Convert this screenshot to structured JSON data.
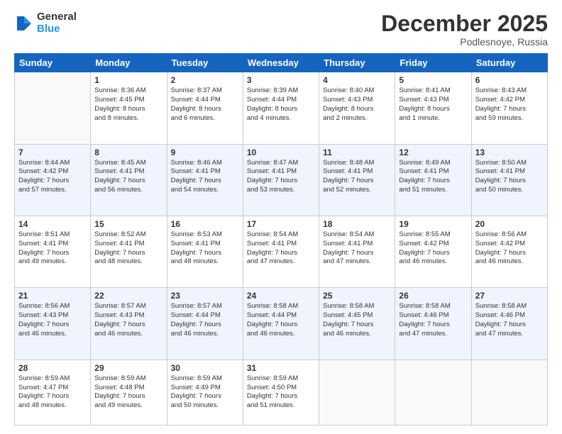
{
  "logo": {
    "general": "General",
    "blue": "Blue"
  },
  "header": {
    "month": "December 2025",
    "location": "Podlesnoye, Russia"
  },
  "weekdays": [
    "Sunday",
    "Monday",
    "Tuesday",
    "Wednesday",
    "Thursday",
    "Friday",
    "Saturday"
  ],
  "weeks": [
    [
      {
        "day": "",
        "info": ""
      },
      {
        "day": "1",
        "info": "Sunrise: 8:36 AM\nSunset: 4:45 PM\nDaylight: 8 hours\nand 8 minutes."
      },
      {
        "day": "2",
        "info": "Sunrise: 8:37 AM\nSunset: 4:44 PM\nDaylight: 8 hours\nand 6 minutes."
      },
      {
        "day": "3",
        "info": "Sunrise: 8:39 AM\nSunset: 4:44 PM\nDaylight: 8 hours\nand 4 minutes."
      },
      {
        "day": "4",
        "info": "Sunrise: 8:40 AM\nSunset: 4:43 PM\nDaylight: 8 hours\nand 2 minutes."
      },
      {
        "day": "5",
        "info": "Sunrise: 8:41 AM\nSunset: 4:43 PM\nDaylight: 8 hours\nand 1 minute."
      },
      {
        "day": "6",
        "info": "Sunrise: 8:43 AM\nSunset: 4:42 PM\nDaylight: 7 hours\nand 59 minutes."
      }
    ],
    [
      {
        "day": "7",
        "info": "Sunrise: 8:44 AM\nSunset: 4:42 PM\nDaylight: 7 hours\nand 57 minutes."
      },
      {
        "day": "8",
        "info": "Sunrise: 8:45 AM\nSunset: 4:41 PM\nDaylight: 7 hours\nand 56 minutes."
      },
      {
        "day": "9",
        "info": "Sunrise: 8:46 AM\nSunset: 4:41 PM\nDaylight: 7 hours\nand 54 minutes."
      },
      {
        "day": "10",
        "info": "Sunrise: 8:47 AM\nSunset: 4:41 PM\nDaylight: 7 hours\nand 53 minutes."
      },
      {
        "day": "11",
        "info": "Sunrise: 8:48 AM\nSunset: 4:41 PM\nDaylight: 7 hours\nand 52 minutes."
      },
      {
        "day": "12",
        "info": "Sunrise: 8:49 AM\nSunset: 4:41 PM\nDaylight: 7 hours\nand 51 minutes."
      },
      {
        "day": "13",
        "info": "Sunrise: 8:50 AM\nSunset: 4:41 PM\nDaylight: 7 hours\nand 50 minutes."
      }
    ],
    [
      {
        "day": "14",
        "info": "Sunrise: 8:51 AM\nSunset: 4:41 PM\nDaylight: 7 hours\nand 49 minutes."
      },
      {
        "day": "15",
        "info": "Sunrise: 8:52 AM\nSunset: 4:41 PM\nDaylight: 7 hours\nand 48 minutes."
      },
      {
        "day": "16",
        "info": "Sunrise: 8:53 AM\nSunset: 4:41 PM\nDaylight: 7 hours\nand 48 minutes."
      },
      {
        "day": "17",
        "info": "Sunrise: 8:54 AM\nSunset: 4:41 PM\nDaylight: 7 hours\nand 47 minutes."
      },
      {
        "day": "18",
        "info": "Sunrise: 8:54 AM\nSunset: 4:41 PM\nDaylight: 7 hours\nand 47 minutes."
      },
      {
        "day": "19",
        "info": "Sunrise: 8:55 AM\nSunset: 4:42 PM\nDaylight: 7 hours\nand 46 minutes."
      },
      {
        "day": "20",
        "info": "Sunrise: 8:56 AM\nSunset: 4:42 PM\nDaylight: 7 hours\nand 46 minutes."
      }
    ],
    [
      {
        "day": "21",
        "info": "Sunrise: 8:56 AM\nSunset: 4:43 PM\nDaylight: 7 hours\nand 46 minutes."
      },
      {
        "day": "22",
        "info": "Sunrise: 8:57 AM\nSunset: 4:43 PM\nDaylight: 7 hours\nand 46 minutes."
      },
      {
        "day": "23",
        "info": "Sunrise: 8:57 AM\nSunset: 4:44 PM\nDaylight: 7 hours\nand 46 minutes."
      },
      {
        "day": "24",
        "info": "Sunrise: 8:58 AM\nSunset: 4:44 PM\nDaylight: 7 hours\nand 46 minutes."
      },
      {
        "day": "25",
        "info": "Sunrise: 8:58 AM\nSunset: 4:45 PM\nDaylight: 7 hours\nand 46 minutes."
      },
      {
        "day": "26",
        "info": "Sunrise: 8:58 AM\nSunset: 4:46 PM\nDaylight: 7 hours\nand 47 minutes."
      },
      {
        "day": "27",
        "info": "Sunrise: 8:58 AM\nSunset: 4:46 PM\nDaylight: 7 hours\nand 47 minutes."
      }
    ],
    [
      {
        "day": "28",
        "info": "Sunrise: 8:59 AM\nSunset: 4:47 PM\nDaylight: 7 hours\nand 48 minutes."
      },
      {
        "day": "29",
        "info": "Sunrise: 8:59 AM\nSunset: 4:48 PM\nDaylight: 7 hours\nand 49 minutes."
      },
      {
        "day": "30",
        "info": "Sunrise: 8:59 AM\nSunset: 4:49 PM\nDaylight: 7 hours\nand 50 minutes."
      },
      {
        "day": "31",
        "info": "Sunrise: 8:59 AM\nSunset: 4:50 PM\nDaylight: 7 hours\nand 51 minutes."
      },
      {
        "day": "",
        "info": ""
      },
      {
        "day": "",
        "info": ""
      },
      {
        "day": "",
        "info": ""
      }
    ]
  ]
}
